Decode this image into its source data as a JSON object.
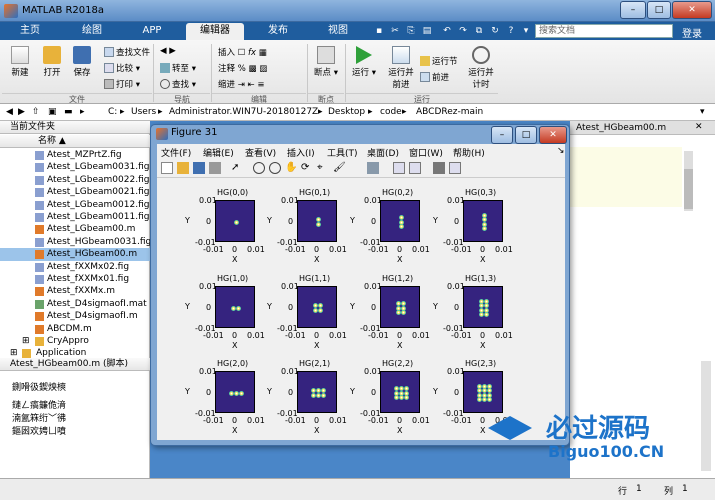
{
  "window": {
    "title": "MATLAB R2018a",
    "min": "–",
    "max": "□",
    "close": "✕"
  },
  "tabs": [
    "主页",
    "绘图",
    "APP",
    "编辑器",
    "发布",
    "视图"
  ],
  "search": {
    "placeholder": "搜索文档",
    "login": "登录"
  },
  "ribbon": {
    "file": {
      "new": "新建",
      "open": "打开",
      "save": "保存",
      "find_files": "查找文件",
      "compare": "比较",
      "print": "打印",
      "group": "文件"
    },
    "nav": {
      "goto": "转至",
      "find": "查找",
      "group": "导航"
    },
    "edit": {
      "insert": "插入",
      "comment": "注释",
      "indent": "缩进",
      "group": "编辑"
    },
    "breakpoints": {
      "label": "断点",
      "group": "断点"
    },
    "run": {
      "run": "运行",
      "run_advance": "运行并前进",
      "run_section": "运行节",
      "advance": "前进",
      "run_time": "运行并计时",
      "group": "运行"
    }
  },
  "path": [
    "C:",
    "Users",
    "Administrator.WIN7U-20180127Z",
    "Desktop",
    "code",
    "ABCDRez-main"
  ],
  "current_folder": {
    "header": "当前文件夹",
    "column": "名称 ▲",
    "files": [
      {
        "name": "Atest_MZPrtZ.fig",
        "type": "fig"
      },
      {
        "name": "Atest_LGbeam0031.fig",
        "type": "fig"
      },
      {
        "name": "Atest_LGbeam0022.fig",
        "type": "fig"
      },
      {
        "name": "Atest_LGbeam0021.fig",
        "type": "fig"
      },
      {
        "name": "Atest_LGbeam0012.fig",
        "type": "fig"
      },
      {
        "name": "Atest_LGbeam0011.fig",
        "type": "fig"
      },
      {
        "name": "Atest_LGbeam00.m",
        "type": "m"
      },
      {
        "name": "Atest_HGbeam0031.fig",
        "type": "fig"
      },
      {
        "name": "Atest_HGbeam00.m",
        "type": "m",
        "selected": true
      },
      {
        "name": "Atest_fXXMx02.fig",
        "type": "fig"
      },
      {
        "name": "Atest_fXXMx01.fig",
        "type": "fig"
      },
      {
        "name": "Atest_fXXMx.m",
        "type": "m"
      },
      {
        "name": "Atest_D4sigmaofI.mat",
        "type": "mat"
      },
      {
        "name": "Atest_D4sigmaofI.m",
        "type": "m"
      },
      {
        "name": "ABCDM.m",
        "type": "m"
      },
      {
        "name": "CryAppro",
        "type": "folder"
      },
      {
        "name": "Application",
        "type": "folder"
      }
    ]
  },
  "details": {
    "header": "Atest_HGbeam00.m  (脚本)",
    "lines": [
      "鍘嗗彶鍥炴樉",
      "鏈ㄥ瘑鐮佹湇",
      "湳氳箖绗﹀彿",
      "鏂囦欢娉ㄩ噴"
    ]
  },
  "editor_tab": "Atest_HGbeam00.m",
  "status": {
    "row_label": "行",
    "row": "1",
    "col_label": "列",
    "col": "1"
  },
  "figure": {
    "title": "Figure 31",
    "menu": [
      "文件(F)",
      "编辑(E)",
      "查看(V)",
      "插入(I)",
      "工具(T)",
      "桌面(D)",
      "窗口(W)",
      "帮助(H)"
    ],
    "subplots": [
      {
        "title": "HG(0,0)",
        "m": 0,
        "n": 0
      },
      {
        "title": "HG(0,1)",
        "m": 0,
        "n": 1
      },
      {
        "title": "HG(0,2)",
        "m": 0,
        "n": 2
      },
      {
        "title": "HG(0,3)",
        "m": 0,
        "n": 3
      },
      {
        "title": "HG(1,0)",
        "m": 1,
        "n": 0
      },
      {
        "title": "HG(1,1)",
        "m": 1,
        "n": 1
      },
      {
        "title": "HG(1,2)",
        "m": 1,
        "n": 2
      },
      {
        "title": "HG(1,3)",
        "m": 1,
        "n": 3
      },
      {
        "title": "HG(2,0)",
        "m": 2,
        "n": 0
      },
      {
        "title": "HG(2,1)",
        "m": 2,
        "n": 1
      },
      {
        "title": "HG(2,2)",
        "m": 2,
        "n": 2
      },
      {
        "title": "HG(2,3)",
        "m": 2,
        "n": 3
      }
    ],
    "xlabel": "X",
    "ylabel": "Y",
    "ticks": [
      "0.01",
      "0",
      "-0.01"
    ],
    "xticks": [
      "-0.01",
      "0",
      "0.01"
    ]
  },
  "watermark": {
    "text": "必过源码",
    "url": "Biguo100.CN"
  }
}
